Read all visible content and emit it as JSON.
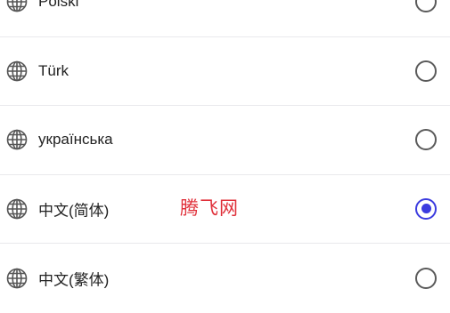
{
  "languages": [
    {
      "label": "Polski",
      "selected": false
    },
    {
      "label": "Türk",
      "selected": false
    },
    {
      "label": "українська",
      "selected": false
    },
    {
      "label": "中文(简体)",
      "selected": true
    },
    {
      "label": "中文(繁体)",
      "selected": false
    }
  ],
  "watermark": "腾飞网",
  "icons": {
    "row_icon": "globe-icon"
  },
  "colors": {
    "accent": "#3b3bdf",
    "watermark": "#e0303a"
  }
}
